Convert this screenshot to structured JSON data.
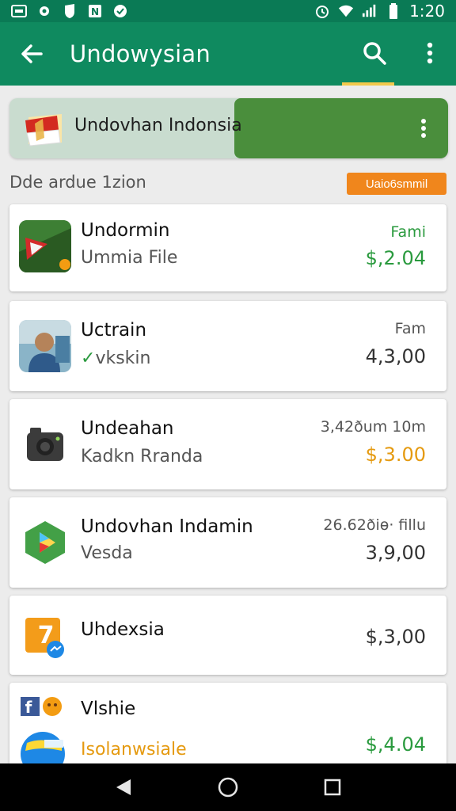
{
  "status_bar": {
    "time": "1:20"
  },
  "app_bar": {
    "title": "Undowysian"
  },
  "banner": {
    "text": "Undovhan Indonsia"
  },
  "section": {
    "label": "Dde ardue 1zion",
    "badge": "Uaio6smmil"
  },
  "items": [
    {
      "name": "Undormin",
      "sub": "Ummia File",
      "meta": "Fami",
      "price": "$,2.04",
      "price_color": "green",
      "meta_color": "green",
      "icon": "play-arrow-icon"
    },
    {
      "name": "Uctrain",
      "sub": "vkskin",
      "meta": "Fam",
      "price": "4,3,00",
      "price_color": "default",
      "meta_color": "default",
      "sub_check": "✓",
      "icon": "person-photo-icon"
    },
    {
      "name": "Undeahan",
      "sub": "Kadkn Rranda",
      "meta": "3,42ðum 10m",
      "price": "$,3.00",
      "price_color": "orange",
      "meta_color": "default",
      "icon": "camera-icon"
    },
    {
      "name": "Undovhan Indamin",
      "sub": "Vesda",
      "meta": "26.62ðiө· fillu",
      "price": "3,9,00",
      "price_color": "default",
      "meta_color": "default",
      "icon": "play-store-icon"
    },
    {
      "name": "Uhdexsia",
      "sub": "",
      "meta": "",
      "price": "$,3,00",
      "price_color": "default",
      "meta_color": "default",
      "icon": "messenger-icon"
    },
    {
      "name": "Vlshie",
      "sub": "Isolanwsiale",
      "meta": "",
      "price": "$,4.04",
      "price_color": "green",
      "meta_color": "default",
      "icon": "social-globe-icon"
    }
  ]
}
